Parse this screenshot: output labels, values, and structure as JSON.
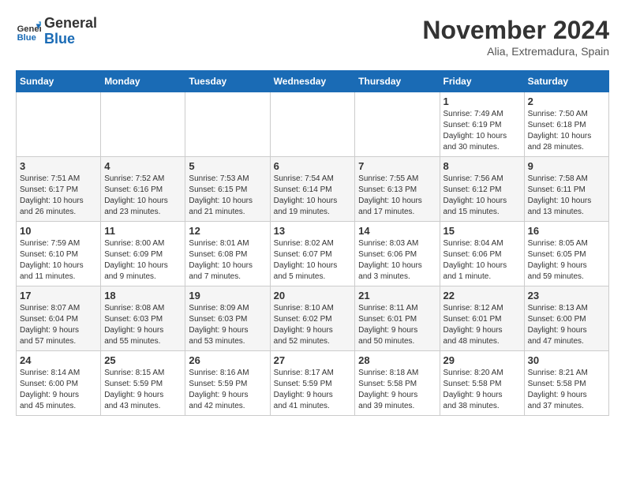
{
  "header": {
    "logo_general": "General",
    "logo_blue": "Blue",
    "month_title": "November 2024",
    "location": "Alia, Extremadura, Spain"
  },
  "weekdays": [
    "Sunday",
    "Monday",
    "Tuesday",
    "Wednesday",
    "Thursday",
    "Friday",
    "Saturday"
  ],
  "weeks": [
    [
      {
        "day": "",
        "info": ""
      },
      {
        "day": "",
        "info": ""
      },
      {
        "day": "",
        "info": ""
      },
      {
        "day": "",
        "info": ""
      },
      {
        "day": "",
        "info": ""
      },
      {
        "day": "1",
        "info": "Sunrise: 7:49 AM\nSunset: 6:19 PM\nDaylight: 10 hours\nand 30 minutes."
      },
      {
        "day": "2",
        "info": "Sunrise: 7:50 AM\nSunset: 6:18 PM\nDaylight: 10 hours\nand 28 minutes."
      }
    ],
    [
      {
        "day": "3",
        "info": "Sunrise: 7:51 AM\nSunset: 6:17 PM\nDaylight: 10 hours\nand 26 minutes."
      },
      {
        "day": "4",
        "info": "Sunrise: 7:52 AM\nSunset: 6:16 PM\nDaylight: 10 hours\nand 23 minutes."
      },
      {
        "day": "5",
        "info": "Sunrise: 7:53 AM\nSunset: 6:15 PM\nDaylight: 10 hours\nand 21 minutes."
      },
      {
        "day": "6",
        "info": "Sunrise: 7:54 AM\nSunset: 6:14 PM\nDaylight: 10 hours\nand 19 minutes."
      },
      {
        "day": "7",
        "info": "Sunrise: 7:55 AM\nSunset: 6:13 PM\nDaylight: 10 hours\nand 17 minutes."
      },
      {
        "day": "8",
        "info": "Sunrise: 7:56 AM\nSunset: 6:12 PM\nDaylight: 10 hours\nand 15 minutes."
      },
      {
        "day": "9",
        "info": "Sunrise: 7:58 AM\nSunset: 6:11 PM\nDaylight: 10 hours\nand 13 minutes."
      }
    ],
    [
      {
        "day": "10",
        "info": "Sunrise: 7:59 AM\nSunset: 6:10 PM\nDaylight: 10 hours\nand 11 minutes."
      },
      {
        "day": "11",
        "info": "Sunrise: 8:00 AM\nSunset: 6:09 PM\nDaylight: 10 hours\nand 9 minutes."
      },
      {
        "day": "12",
        "info": "Sunrise: 8:01 AM\nSunset: 6:08 PM\nDaylight: 10 hours\nand 7 minutes."
      },
      {
        "day": "13",
        "info": "Sunrise: 8:02 AM\nSunset: 6:07 PM\nDaylight: 10 hours\nand 5 minutes."
      },
      {
        "day": "14",
        "info": "Sunrise: 8:03 AM\nSunset: 6:06 PM\nDaylight: 10 hours\nand 3 minutes."
      },
      {
        "day": "15",
        "info": "Sunrise: 8:04 AM\nSunset: 6:06 PM\nDaylight: 10 hours\nand 1 minute."
      },
      {
        "day": "16",
        "info": "Sunrise: 8:05 AM\nSunset: 6:05 PM\nDaylight: 9 hours\nand 59 minutes."
      }
    ],
    [
      {
        "day": "17",
        "info": "Sunrise: 8:07 AM\nSunset: 6:04 PM\nDaylight: 9 hours\nand 57 minutes."
      },
      {
        "day": "18",
        "info": "Sunrise: 8:08 AM\nSunset: 6:03 PM\nDaylight: 9 hours\nand 55 minutes."
      },
      {
        "day": "19",
        "info": "Sunrise: 8:09 AM\nSunset: 6:03 PM\nDaylight: 9 hours\nand 53 minutes."
      },
      {
        "day": "20",
        "info": "Sunrise: 8:10 AM\nSunset: 6:02 PM\nDaylight: 9 hours\nand 52 minutes."
      },
      {
        "day": "21",
        "info": "Sunrise: 8:11 AM\nSunset: 6:01 PM\nDaylight: 9 hours\nand 50 minutes."
      },
      {
        "day": "22",
        "info": "Sunrise: 8:12 AM\nSunset: 6:01 PM\nDaylight: 9 hours\nand 48 minutes."
      },
      {
        "day": "23",
        "info": "Sunrise: 8:13 AM\nSunset: 6:00 PM\nDaylight: 9 hours\nand 47 minutes."
      }
    ],
    [
      {
        "day": "24",
        "info": "Sunrise: 8:14 AM\nSunset: 6:00 PM\nDaylight: 9 hours\nand 45 minutes."
      },
      {
        "day": "25",
        "info": "Sunrise: 8:15 AM\nSunset: 5:59 PM\nDaylight: 9 hours\nand 43 minutes."
      },
      {
        "day": "26",
        "info": "Sunrise: 8:16 AM\nSunset: 5:59 PM\nDaylight: 9 hours\nand 42 minutes."
      },
      {
        "day": "27",
        "info": "Sunrise: 8:17 AM\nSunset: 5:59 PM\nDaylight: 9 hours\nand 41 minutes."
      },
      {
        "day": "28",
        "info": "Sunrise: 8:18 AM\nSunset: 5:58 PM\nDaylight: 9 hours\nand 39 minutes."
      },
      {
        "day": "29",
        "info": "Sunrise: 8:20 AM\nSunset: 5:58 PM\nDaylight: 9 hours\nand 38 minutes."
      },
      {
        "day": "30",
        "info": "Sunrise: 8:21 AM\nSunset: 5:58 PM\nDaylight: 9 hours\nand 37 minutes."
      }
    ]
  ]
}
